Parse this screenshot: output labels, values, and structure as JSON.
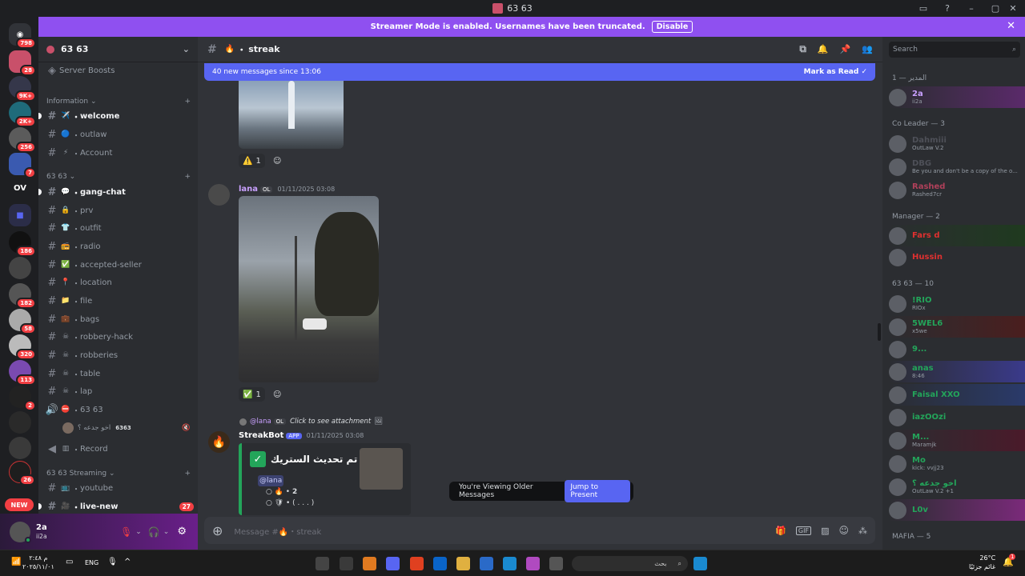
{
  "window": {
    "title": "63 63"
  },
  "banner": {
    "text": "Streamer Mode is enabled. Usernames have been truncated.",
    "disable": "Disable"
  },
  "servers": [
    {
      "badge": "798"
    },
    {
      "badge": "28"
    },
    {
      "badge": "9K+"
    },
    {
      "badge": "2K+"
    },
    {
      "badge": "256"
    },
    {
      "badge": "7"
    },
    {
      "label": "OV"
    },
    {
      "badge": ""
    },
    {
      "badge": "186"
    },
    {
      "badge": ""
    },
    {
      "badge": "182"
    },
    {
      "badge": "58"
    },
    {
      "badge": "320"
    },
    {
      "badge": "113"
    },
    {
      "badge": "2"
    },
    {
      "badge": ""
    },
    {
      "badge": ""
    },
    {
      "badge": "26"
    },
    {
      "label": "NEW"
    }
  ],
  "sidebar": {
    "server_name": "63 63",
    "boosts": "Server Boosts",
    "cat_info": "Information",
    "cat_6363": "63 63",
    "cat_stream": "63 63 Streaming",
    "channels": [
      {
        "emoji": "✈️",
        "name": "welcome",
        "unread": true
      },
      {
        "emoji": "🔵",
        "name": "outlaw"
      },
      {
        "emoji": "⚡",
        "name": "Account"
      },
      {
        "emoji": "💬",
        "name": "gang-chat",
        "unread": true
      },
      {
        "emoji": "🔒",
        "name": "prv"
      },
      {
        "emoji": "👕",
        "name": "outfit"
      },
      {
        "emoji": "📻",
        "name": "radio"
      },
      {
        "emoji": "✅",
        "name": "accepted-seller"
      },
      {
        "emoji": "📍",
        "name": "location"
      },
      {
        "emoji": "📁",
        "name": "file"
      },
      {
        "emoji": "💼",
        "name": "bags"
      },
      {
        "emoji": "☠",
        "name": "robbery-hack"
      },
      {
        "emoji": "☠",
        "name": "robberies"
      },
      {
        "emoji": "☠",
        "name": "table"
      },
      {
        "emoji": "☠",
        "name": "lap"
      }
    ],
    "voice": {
      "emoji": "⛔",
      "name": "63 63"
    },
    "voice_user": {
      "name": "اخو جدعه ؟",
      "tag": "6363"
    },
    "record": "Record",
    "stream_channels": [
      {
        "emoji": "📺",
        "name": "youtube"
      },
      {
        "emoji": "🎥",
        "name": "live-new",
        "count": "27",
        "unread": true
      }
    ]
  },
  "user": {
    "name": "2a",
    "status": "ii2a"
  },
  "chat": {
    "channel": "streak",
    "channel_emoji": "🔥",
    "new_messages": "40 new messages since 13:06",
    "mark_read": "Mark as Read",
    "reaction1": {
      "emoji": "⚠️",
      "count": "1"
    },
    "msg1": {
      "author": "lana",
      "tag": "OL",
      "time": "01/11/2025 03:08"
    },
    "reaction2": {
      "emoji": "✅",
      "count": "1"
    },
    "reply": {
      "author": "@lana",
      "tag": "OL",
      "text": "Click to see attachment"
    },
    "msg2": {
      "author": "StreakBot",
      "app": "APP",
      "time": "01/11/2025 03:08"
    },
    "embed": {
      "title": "تم تحديث الستريك •",
      "mention": "@lana",
      "line1": "2",
      "line2": "( . . . )"
    },
    "older": "You're Viewing Older Messages",
    "jump": "Jump to Present",
    "composer": "Message #🔥・streak"
  },
  "members": {
    "search": "Search",
    "categories": [
      "المدير — 1",
      "Co Leader — 3",
      "Manager — 2",
      "63 63 — 10",
      "MAFIA — 5"
    ],
    "list": [
      {
        "name": "2a",
        "sub": "ii2a",
        "color": "#c9a0ff",
        "tag": "OL"
      },
      {
        "name": "Dahmiii",
        "sub": "OutLaw V.2",
        "color": "#4e5058"
      },
      {
        "name": "DBG",
        "sub": "Be you and don't be a copy of the o...",
        "color": "#4e5058",
        "tag": "OL"
      },
      {
        "name": "Rashed",
        "sub": "Rashed7cr",
        "color": "#b0405a",
        "tag": "6363"
      },
      {
        "name": "Fars d",
        "sub": "",
        "color": "#e03030"
      },
      {
        "name": "Hussin",
        "sub": "",
        "color": "#e03030",
        "tag": "057"
      },
      {
        "name": "!RIO",
        "sub": "RIOx",
        "color": "#23a55a",
        "tag": "OL"
      },
      {
        "name": "5WEL6",
        "sub": "x5we",
        "color": "#23a55a"
      },
      {
        "name": "9...",
        "sub": "",
        "color": "#23a55a",
        "tag": "6363"
      },
      {
        "name": "anas",
        "sub": "8:46",
        "color": "#23a55a"
      },
      {
        "name": "Faisal XXO",
        "sub": "",
        "color": "#23a55a"
      },
      {
        "name": "iazOOzi",
        "sub": "",
        "color": "#23a55a",
        "tag": "OL"
      },
      {
        "name": "M...",
        "sub": "Maramjk",
        "color": "#23a55a"
      },
      {
        "name": "Mo",
        "sub": "kick: vvjj23",
        "color": "#23a55a",
        "tag": "OL"
      },
      {
        "name": "اخو جدعه ؟",
        "sub": "OutLaw V.2 +1",
        "color": "#23a55a",
        "tag": "6363"
      },
      {
        "name": "L0v",
        "sub": "",
        "color": "#23a55a"
      }
    ]
  },
  "taskbar": {
    "lang": "ENG",
    "time_left": "م ٢:٤٨",
    "date_left": "٢٠٢٥/١١/٠١",
    "search": "بحث",
    "temp": "26°C",
    "weather": "غائم جزئيًا",
    "notif": "1"
  },
  "colors": {
    "accent": "#5865f2",
    "banner": "#8f50f0",
    "online": "#23a55a"
  }
}
